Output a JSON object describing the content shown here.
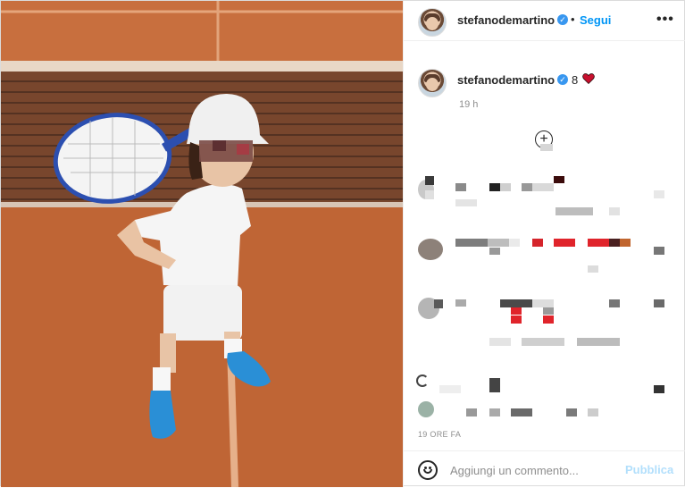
{
  "post": {
    "username": "stefanodemartino",
    "follow_label": "Segui",
    "separator": "•",
    "more_label": "•••",
    "verified_glyph": "✓"
  },
  "caption": {
    "username": "stefanodemartino",
    "text": "8",
    "emoji": "heart-emoji",
    "time": "19 h"
  },
  "load_more_icon": "+",
  "footer": {
    "time": "19 ORE FA",
    "comment_placeholder": "Aggiungi un commento...",
    "publish_label": "Pubblica"
  },
  "colors": {
    "accent": "#0095f6",
    "publish_disabled": "#b2dffc",
    "verified": "#3897f0",
    "court": "#c56a37"
  }
}
